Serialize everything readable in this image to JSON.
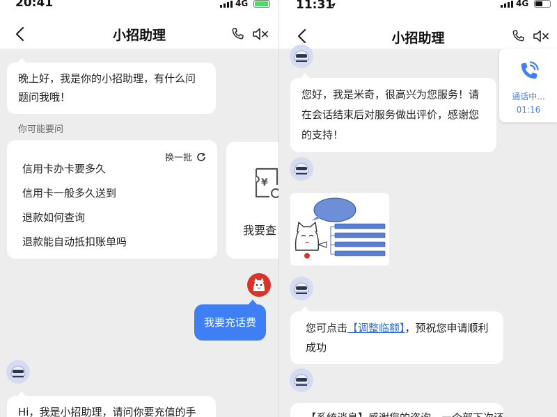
{
  "left": {
    "status": {
      "time": "20:41",
      "network": "4G"
    },
    "nav": {
      "title": "小招助理"
    },
    "greeting": {
      "line1": "晚上好，我是你的小招助理，有什么问",
      "line2": "题问我哦！"
    },
    "suggest_caption": "你可能要问",
    "questions": {
      "refresh_label": "换一批",
      "items": [
        "信用卡办卡要多久",
        "信用卡一般多久送到",
        "退款如何查询",
        "退款能自动抵扣账单吗"
      ]
    },
    "service_card": {
      "label": "我要查",
      "icon_glyph": "¥"
    },
    "user_message": "我要充话费",
    "bot_reply_partial": "Hi，我是小招助理，请问你要充值的手"
  },
  "right": {
    "status": {
      "time": "11:31",
      "network": "4G"
    },
    "nav": {
      "title": "小招助理"
    },
    "call": {
      "status": "通话中...",
      "duration": "01:16"
    },
    "agent_message": {
      "line1": "您好，我是米奇，很高兴为您服务！请",
      "line2": "在会话结束后对服务做出评价，感谢您",
      "line3": "的支持！"
    },
    "limit_message": {
      "prefix": "您可点击",
      "link": "【调整临额】",
      "suffix": "，预祝您申请顺利",
      "line2": "成功"
    },
    "partial_message": "【系统消息】感谢您的咨询，ー个部下次还"
  },
  "colors": {
    "accent": "#3f7ff5",
    "link": "#2e6fe0",
    "background": "#ededed",
    "battery_green": "#4cd964"
  }
}
